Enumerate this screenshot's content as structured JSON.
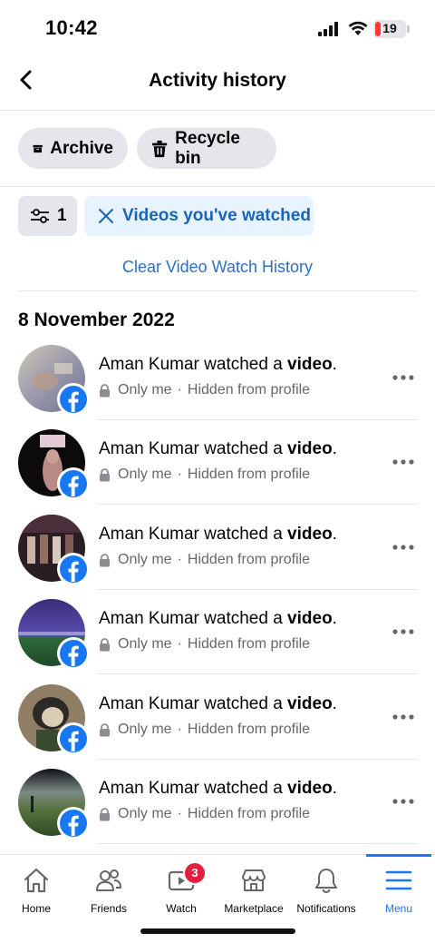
{
  "status_bar": {
    "time": "10:42",
    "battery_level": "19",
    "battery_percent": 19
  },
  "header": {
    "title": "Activity history",
    "back_icon": "chevron-left-icon"
  },
  "chips": {
    "archive_label": "Archive",
    "recycle_label": "Recycle bin"
  },
  "filters": {
    "count": "1",
    "active_filter": "Videos you've watched"
  },
  "clear_link": "Clear Video Watch History",
  "date_heading": "8 November 2022",
  "activity": {
    "items": [
      {
        "actor": "Aman Kumar watched a ",
        "object": "video",
        "end": ".",
        "privacy": "Only me",
        "dot": "·",
        "visibility": "Hidden from profile"
      },
      {
        "actor": "Aman Kumar watched a ",
        "object": "video",
        "end": ".",
        "privacy": "Only me",
        "dot": "·",
        "visibility": "Hidden from profile"
      },
      {
        "actor": "Aman Kumar watched a ",
        "object": "video",
        "end": ".",
        "privacy": "Only me",
        "dot": "·",
        "visibility": "Hidden from profile"
      },
      {
        "actor": "Aman Kumar watched a ",
        "object": "video",
        "end": ".",
        "privacy": "Only me",
        "dot": "·",
        "visibility": "Hidden from profile"
      },
      {
        "actor": "Aman Kumar watched a ",
        "object": "video",
        "end": ".",
        "privacy": "Only me",
        "dot": "·",
        "visibility": "Hidden from profile"
      },
      {
        "actor": "Aman Kumar watched a ",
        "object": "video",
        "end": ".",
        "privacy": "Only me",
        "dot": "·",
        "visibility": "Hidden from profile"
      }
    ]
  },
  "bottom_nav": {
    "items": [
      {
        "label": "Home",
        "icon": "home-icon"
      },
      {
        "label": "Friends",
        "icon": "friends-icon"
      },
      {
        "label": "Watch",
        "icon": "watch-icon",
        "badge": "3"
      },
      {
        "label": "Marketplace",
        "icon": "marketplace-icon"
      },
      {
        "label": "Notifications",
        "icon": "bell-icon"
      },
      {
        "label": "Menu",
        "icon": "menu-icon",
        "active": true
      }
    ]
  },
  "colors": {
    "accent": "#1877f2",
    "link": "#2d6fc2",
    "chip_bg": "#e4e6eb",
    "filter_bg": "#e7f3ff",
    "muted_text": "#65676b",
    "badge_red": "#e41e3f"
  }
}
